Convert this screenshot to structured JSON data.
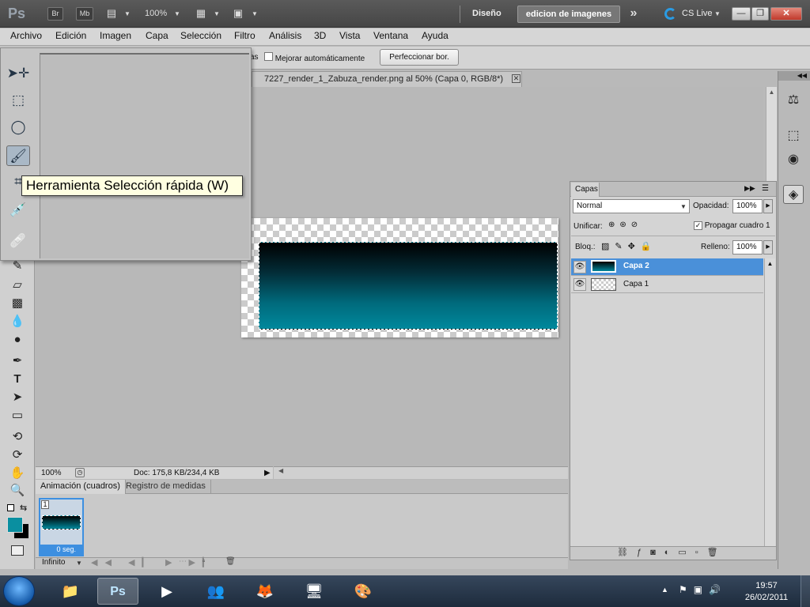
{
  "appbar": {
    "logo": "Ps",
    "bridge_label": "Br",
    "minibridge_label": "Mb",
    "zoom": "100%",
    "workspace_label": "Diseño",
    "workspace_active": "edicion de imagenes",
    "cslive_label": "CS Live"
  },
  "menus": [
    "Archivo",
    "Edición",
    "Imagen",
    "Capa",
    "Selección",
    "Filtro",
    "Análisis",
    "3D",
    "Vista",
    "Ventana",
    "Ayuda"
  ],
  "options": {
    "partial_label": "as",
    "auto_enhance_label": "Mejorar automáticamente",
    "refine_button": "Perfeccionar bor."
  },
  "tooltip": "Herramienta Selección rápida (W)",
  "document": {
    "tab_title": "7227_render_1_Zabuza_render.png al 50% (Capa 0, RGB/8*)",
    "close_glyph": "✕"
  },
  "status": {
    "zoom": "100%",
    "doc_info": "Doc: 175,8 KB/234,4 KB"
  },
  "animation": {
    "tab_active": "Animación (cuadros)",
    "tab_other": "Registro de medidas",
    "frame_number": "1",
    "frame_delay": "0 seg.",
    "loop": "Infinito"
  },
  "layers_panel": {
    "tab": "Capas",
    "blend_mode": "Normal",
    "opacity_label": "Opacidad:",
    "opacity_value": "100%",
    "unify_label": "Unificar:",
    "propagate_label": "Propagar cuadro 1",
    "lock_label": "Bloq.:",
    "fill_label": "Relleno:",
    "fill_value": "100%",
    "layers": [
      {
        "name": "Capa 2",
        "selected": true
      },
      {
        "name": "Capa 1",
        "selected": false
      }
    ]
  },
  "taskbar": {
    "time": "19:57",
    "date": "26/02/2011"
  },
  "colors": {
    "foreground": "#0a8fa0",
    "background": "#000000",
    "selection": "#4a90d9",
    "accent_blue": "#3d8fe0"
  }
}
